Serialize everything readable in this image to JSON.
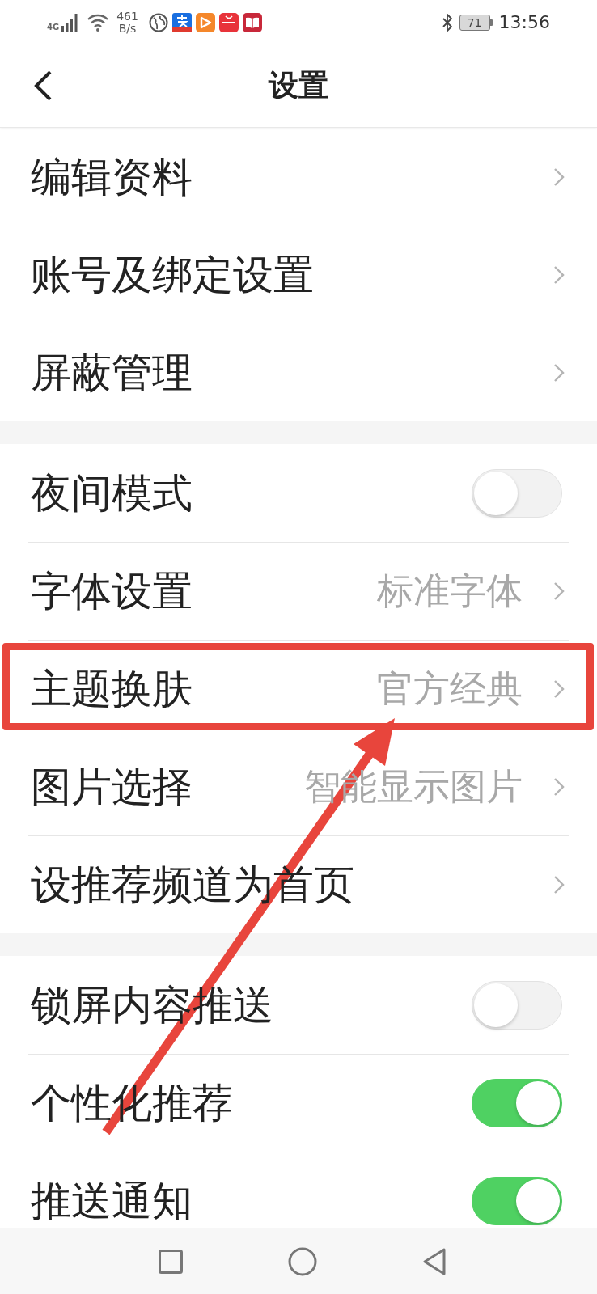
{
  "status_bar": {
    "network": "4G",
    "speed_value": "461",
    "speed_unit": "B/s",
    "battery": "71",
    "time": "13:56"
  },
  "header": {
    "title": "设置"
  },
  "groups": [
    {
      "items": [
        {
          "kind": "link",
          "label": "编辑资料",
          "highlighted": false
        },
        {
          "kind": "link",
          "label": "账号及绑定设置",
          "highlighted": false
        },
        {
          "kind": "link",
          "label": "屏蔽管理",
          "highlighted": false
        }
      ]
    },
    {
      "items": [
        {
          "kind": "toggle",
          "label": "夜间模式",
          "on": false,
          "highlighted": false
        },
        {
          "kind": "link",
          "label": "字体设置",
          "value": "标准字体",
          "highlighted": false
        },
        {
          "kind": "link",
          "label": "主题换肤",
          "value": "官方经典",
          "highlighted": true
        },
        {
          "kind": "link",
          "label": "图片选择",
          "value": "智能显示图片",
          "highlighted": false
        },
        {
          "kind": "link",
          "label": "设推荐频道为首页",
          "highlighted": false
        }
      ]
    },
    {
      "items": [
        {
          "kind": "toggle",
          "label": "锁屏内容推送",
          "on": false,
          "highlighted": false
        },
        {
          "kind": "toggle",
          "label": "个性化推荐",
          "on": true,
          "highlighted": false
        },
        {
          "kind": "toggle",
          "label": "推送通知",
          "on": true,
          "highlighted": false
        }
      ]
    }
  ]
}
